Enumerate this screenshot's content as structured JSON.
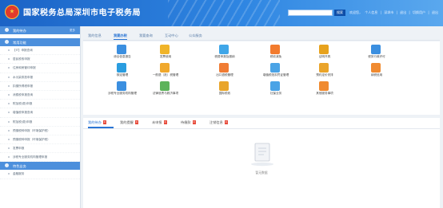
{
  "header": {
    "title": "国家税务总局深圳市电子税务局",
    "search_placeholder": "",
    "search_button": "搜索",
    "links": [
      "欢迎您，",
      "个人信息",
      "|",
      "深圳市",
      "|",
      "退出",
      "|",
      "切换用户",
      "|",
      "退出"
    ]
  },
  "sidebar": {
    "home": {
      "label": "我的待办",
      "action": "更多"
    },
    "section1": {
      "label": "常用功能"
    },
    "items": [
      "【IT】申报查询",
      "居民税收申报",
      "住房和房管印申报",
      "水污染排放申报",
      "扣缴所得税申报",
      "消费税申报查询",
      "附加税(费)申报",
      "增值税申报查询",
      "附加税(费)申报",
      "预缴税种申报（环境保护税）",
      "预缴税种申报（环境保护税）",
      "发票申报",
      "涉税专业服务机构管理申报"
    ],
    "section2": {
      "label": "特色业务"
    },
    "last_item": "金融服务"
  },
  "tabs": [
    "我的信息",
    "我要办税",
    "我要查询",
    "互动中心",
    "公众服务"
  ],
  "services": [
    {
      "label": "综合信息报告",
      "color": "#3b8fe0"
    },
    {
      "label": "发票使用",
      "color": "#f0b429"
    },
    {
      "label": "税费申报及缴纳",
      "color": "#3fa6e8"
    },
    {
      "label": "税收减免",
      "color": "#f27b2e"
    },
    {
      "label": "证明开具",
      "color": "#e7a21d"
    },
    {
      "label": "税务行政许可",
      "color": "#3b8fe0"
    },
    {
      "label": "核定管理",
      "color": "#2a9de0"
    },
    {
      "label": "一般退（抵）税管理",
      "color": "#f0a82c"
    },
    {
      "label": "出口退税管理",
      "color": "#f07c34"
    },
    {
      "label": "增值税抵扣凭证管理",
      "color": "#4aa3e6"
    },
    {
      "label": "预约定价安排",
      "color": "#eaa42a"
    },
    {
      "label": "纳税信用",
      "color": "#f08a30"
    },
    {
      "label": "涉税专业服务机构管理",
      "color": "#3b8fe0"
    },
    {
      "label": "法律追责与救济事项",
      "color": "#5db35b"
    },
    {
      "label": "国际税收",
      "color": "#e9a52b"
    },
    {
      "label": "社保业务",
      "color": "#4aa3e6"
    },
    {
      "label": "其他服务事项",
      "color": "#f08a30"
    }
  ],
  "panel": {
    "tabs": [
      {
        "label": "我的待办",
        "count": "0"
      },
      {
        "label": "我的提醒",
        "count": "0"
      },
      {
        "label": "未申报",
        "count": "0"
      },
      {
        "label": "待缴款",
        "count": "0"
      },
      {
        "label": "注销信息",
        "count": "0"
      }
    ],
    "empty_text": "暂无数据"
  }
}
